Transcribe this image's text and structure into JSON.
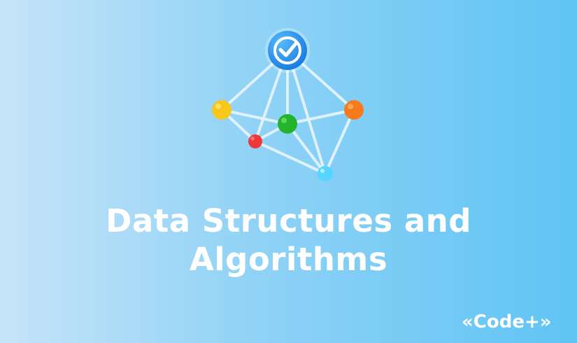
{
  "title": {
    "line1": "Data Structures and",
    "line2": "Algorithms"
  },
  "brand": {
    "text": "«Code+»"
  },
  "icons": {
    "hub": "check-badge-icon",
    "nodes": [
      "yellow-node",
      "green-node",
      "orange-node",
      "red-node",
      "cyan-node"
    ]
  },
  "colors": {
    "background_left": "#c6e4f8",
    "background_right": "#5fc4f4",
    "text": "#ffffff",
    "edge": "#e8f5fd",
    "hub": "#2f8ee8",
    "node_yellow": "#f7c719",
    "node_green": "#23b42c",
    "node_orange": "#f77a1c",
    "node_red": "#ec3838",
    "node_cyan": "#55d5ff"
  }
}
